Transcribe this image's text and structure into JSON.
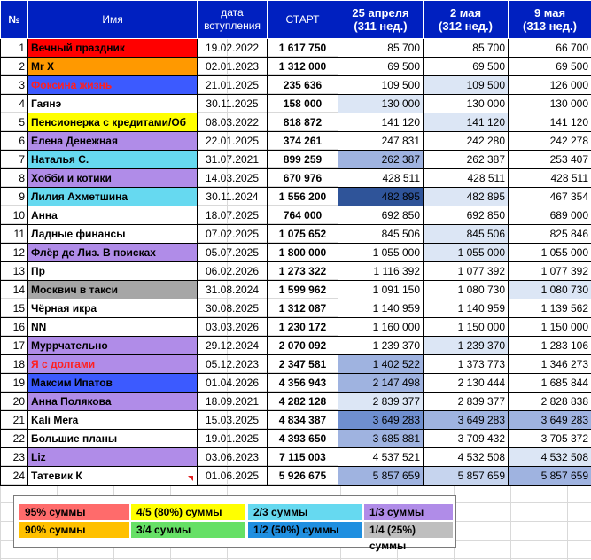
{
  "header": {
    "num": "№",
    "name": "Имя",
    "date_line1": "дата",
    "date_line2": "вступления",
    "start": "СТАРТ",
    "col1_line1": "25 апреля",
    "col1_line2": "(311 нед.)",
    "col2_line1": "2 мая",
    "col2_line2": "(312 нед.)",
    "col3_line1": "9 мая",
    "col3_line2": "(313 нед.)"
  },
  "rows": [
    {
      "num": "1",
      "name": "Вечный праздник",
      "date": "19.02.2022",
      "start": "1 617 750",
      "v1": "85 700",
      "v2": "85 700",
      "v3": "66 700",
      "name_bg": "#ff0000",
      "name_color": "#000000",
      "bg1": "#ffffff",
      "bg2": "#ffffff",
      "bg3": "#ffffff"
    },
    {
      "num": "2",
      "name": "Mr X",
      "date": "02.01.2023",
      "start": "1 312 000",
      "v1": "69 500",
      "v2": "69 500",
      "v3": "69 500",
      "name_bg": "#ff9900",
      "name_color": "#000000",
      "bg1": "#ffffff",
      "bg2": "#ffffff",
      "bg3": "#ffffff"
    },
    {
      "num": "3",
      "name": "Фоксина жизнь",
      "date": "21.01.2025",
      "start": "235 636",
      "v1": "109 500",
      "v2": "109 500",
      "v3": "126 000",
      "name_bg": "#3c5aff",
      "name_color": "#ff2020",
      "bg1": "#ffffff",
      "bg2": "#dce6f5",
      "bg3": "#ffffff"
    },
    {
      "num": "4",
      "name": "Гаянэ",
      "date": "30.11.2025",
      "start": "158 000",
      "v1": "130 000",
      "v2": "130 000",
      "v3": "130 000",
      "name_bg": "#ffffff",
      "name_color": "#000000",
      "bg1": "#dce6f5",
      "bg2": "#ffffff",
      "bg3": "#ffffff"
    },
    {
      "num": "5",
      "name": "Пенсионерка с кредитами/Об",
      "date": "08.03.2022",
      "start": "818 872",
      "v1": "141 120",
      "v2": "141 120",
      "v3": "141 120",
      "name_bg": "#ffff00",
      "name_color": "#000000",
      "bg1": "#ffffff",
      "bg2": "#dce6f5",
      "bg3": "#ffffff"
    },
    {
      "num": "6",
      "name": "Елена Денежная",
      "date": "22.01.2025",
      "start": "374 261",
      "v1": "247 831",
      "v2": "242 280",
      "v3": "242 278",
      "name_bg": "#b08ce8",
      "name_color": "#000000",
      "bg1": "#ffffff",
      "bg2": "#ffffff",
      "bg3": "#ffffff"
    },
    {
      "num": "7",
      "name": "Наталья С.",
      "date": "31.07.2021",
      "start": "899 259",
      "v1": "262 387",
      "v2": "262 387",
      "v3": "253 407",
      "name_bg": "#66d9f0",
      "name_color": "#000000",
      "bg1": "#9fb3e0",
      "bg2": "#ffffff",
      "bg3": "#ffffff"
    },
    {
      "num": "8",
      "name": "Хобби и котики",
      "date": "14.03.2025",
      "start": "670 976",
      "v1": "428 511",
      "v2": "428 511",
      "v3": "428 511",
      "name_bg": "#b08ce8",
      "name_color": "#000000",
      "bg1": "#ffffff",
      "bg2": "#ffffff",
      "bg3": "#ffffff"
    },
    {
      "num": "9",
      "name": "Лилия Ахметшина",
      "date": "30.11.2024",
      "start": "1 556 200",
      "v1": "482 895",
      "v2": "482 895",
      "v3": "467 354",
      "name_bg": "#66d9f0",
      "name_color": "#000000",
      "bg1": "#2f5499",
      "bg2": "#dce6f5",
      "bg3": "#ffffff"
    },
    {
      "num": "10",
      "name": "Анна",
      "date": "18.07.2025",
      "start": "764 000",
      "v1": "692 850",
      "v2": "692 850",
      "v3": "689 000",
      "name_bg": "#ffffff",
      "name_color": "#000000",
      "bg1": "#ffffff",
      "bg2": "#ffffff",
      "bg3": "#ffffff"
    },
    {
      "num": "11",
      "name": "Ладные финансы",
      "date": "07.02.2025",
      "start": "1 075 652",
      "v1": "845 506",
      "v2": "845 506",
      "v3": "825 846",
      "name_bg": "#ffffff",
      "name_color": "#000000",
      "bg1": "#ffffff",
      "bg2": "#dce6f5",
      "bg3": "#ffffff"
    },
    {
      "num": "12",
      "name": "Флёр де Лиз. В поисках",
      "date": "05.07.2025",
      "start": "1 800 000",
      "v1": "1 055 000",
      "v2": "1 055 000",
      "v3": "1 055 000",
      "name_bg": "#b08ce8",
      "name_color": "#000000",
      "bg1": "#ffffff",
      "bg2": "#dce6f5",
      "bg3": "#ffffff"
    },
    {
      "num": "13",
      "name": "Пр",
      "date": "06.02.2026",
      "start": "1 273 322",
      "v1": "1 116 392",
      "v2": "1 077 392",
      "v3": "1 077 392",
      "name_bg": "#ffffff",
      "name_color": "#000000",
      "bg1": "#ffffff",
      "bg2": "#ffffff",
      "bg3": "#ffffff"
    },
    {
      "num": "14",
      "name": "Москвич в такси",
      "date": "31.08.2024",
      "start": "1 599 962",
      "v1": "1 091 150",
      "v2": "1 080 730",
      "v3": "1 080 730",
      "name_bg": "#a6a6a6",
      "name_color": "#000000",
      "bg1": "#ffffff",
      "bg2": "#ffffff",
      "bg3": "#dce6f5"
    },
    {
      "num": "15",
      "name": "Чёрная икра",
      "date": "30.08.2025",
      "start": "1 312 087",
      "v1": "1 140 959",
      "v2": "1 140 959",
      "v3": "1 139 562",
      "name_bg": "#ffffff",
      "name_color": "#000000",
      "bg1": "#ffffff",
      "bg2": "#ffffff",
      "bg3": "#ffffff"
    },
    {
      "num": "16",
      "name": "NN",
      "date": "03.03.2026",
      "start": "1 230 172",
      "v1": "1 160 000",
      "v2": "1 150 000",
      "v3": "1 150 000",
      "name_bg": "#ffffff",
      "name_color": "#000000",
      "bg1": "#ffffff",
      "bg2": "#ffffff",
      "bg3": "#ffffff"
    },
    {
      "num": "17",
      "name": "Муррчательно",
      "date": "29.12.2024",
      "start": "2 070 092",
      "v1": "1 239 370",
      "v2": "1 239 370",
      "v3": "1 283 106",
      "name_bg": "#b08ce8",
      "name_color": "#000000",
      "bg1": "#ffffff",
      "bg2": "#dce6f5",
      "bg3": "#ffffff"
    },
    {
      "num": "18",
      "name": "Я с долгами",
      "date": "05.12.2023",
      "start": "2 347 581",
      "v1": "1 402 522",
      "v2": "1 373 773",
      "v3": "1 346 273",
      "name_bg": "#b08ce8",
      "name_color": "#ff2020",
      "bg1": "#9fb3e0",
      "bg2": "#ffffff",
      "bg3": "#ffffff"
    },
    {
      "num": "19",
      "name": "Максим Ипатов",
      "date": "01.04.2026",
      "start": "4 356 943",
      "v1": "2 147 498",
      "v2": "2 130 444",
      "v3": "1 685 844",
      "name_bg": "#3c5aff",
      "name_color": "#000000",
      "bg1": "#9fb3e0",
      "bg2": "#ffffff",
      "bg3": "#ffffff"
    },
    {
      "num": "20",
      "name": "Анна Полякова",
      "date": "18.09.2021",
      "start": "4 282 128",
      "v1": "2 839 377",
      "v2": "2 839 377",
      "v3": "2 828 838",
      "name_bg": "#b08ce8",
      "name_color": "#000000",
      "bg1": "#dce6f5",
      "bg2": "#ffffff",
      "bg3": "#ffffff"
    },
    {
      "num": "21",
      "name": "Kali Mera",
      "date": "15.03.2025",
      "start": "4 834 387",
      "v1": "3 649 283",
      "v2": "3 649 283",
      "v3": "3 649 283",
      "name_bg": "#ffffff",
      "name_color": "#000000",
      "bg1": "#6f8fd0",
      "bg2": "#9fb3e0",
      "bg3": "#9fb3e0"
    },
    {
      "num": "22",
      "name": "Большие планы",
      "date": "19.01.2025",
      "start": "4 393 650",
      "v1": "3 685 881",
      "v2": "3 709 432",
      "v3": "3 705 372",
      "name_bg": "#ffffff",
      "name_color": "#000000",
      "bg1": "#9fb3e0",
      "bg2": "#ffffff",
      "bg3": "#ffffff"
    },
    {
      "num": "23",
      "name": "Liz",
      "date": "03.06.2023",
      "start": "7 115 003",
      "v1": "4 537 521",
      "v2": "4 532 508",
      "v3": "4 532 508",
      "name_bg": "#b08ce8",
      "name_color": "#000000",
      "bg1": "#ffffff",
      "bg2": "#ffffff",
      "bg3": "#dce6f5"
    },
    {
      "num": "24",
      "name": "Татевик К",
      "date": "01.06.2025",
      "start": "5 926 675",
      "v1": "5 857 659",
      "v2": "5 857 659",
      "v3": "5 857 659",
      "name_bg": "#ffffff",
      "name_color": "#000000",
      "bg1": "#9fb3e0",
      "bg2": "#c6d4ee",
      "bg3": "#9fb3e0"
    }
  ],
  "legend": [
    {
      "label": "95% суммы",
      "color": "#ff6b6b"
    },
    {
      "label": "4/5 (80%) суммы",
      "color": "#ffff00"
    },
    {
      "label": "2/3 суммы",
      "color": "#66d9f0"
    },
    {
      "label": "1/3 суммы",
      "color": "#b08ce8"
    },
    {
      "label": "90% суммы",
      "color": "#ffc000"
    },
    {
      "label": "3/4 суммы",
      "color": "#66e066"
    },
    {
      "label": "1/2 (50%) суммы",
      "color": "#1f8fe0"
    },
    {
      "label": "1/4 (25%) суммы",
      "color": "#bfbfbf"
    }
  ],
  "colors": {
    "header_bg": "#0020c0",
    "corner_mark": "#e02020"
  }
}
